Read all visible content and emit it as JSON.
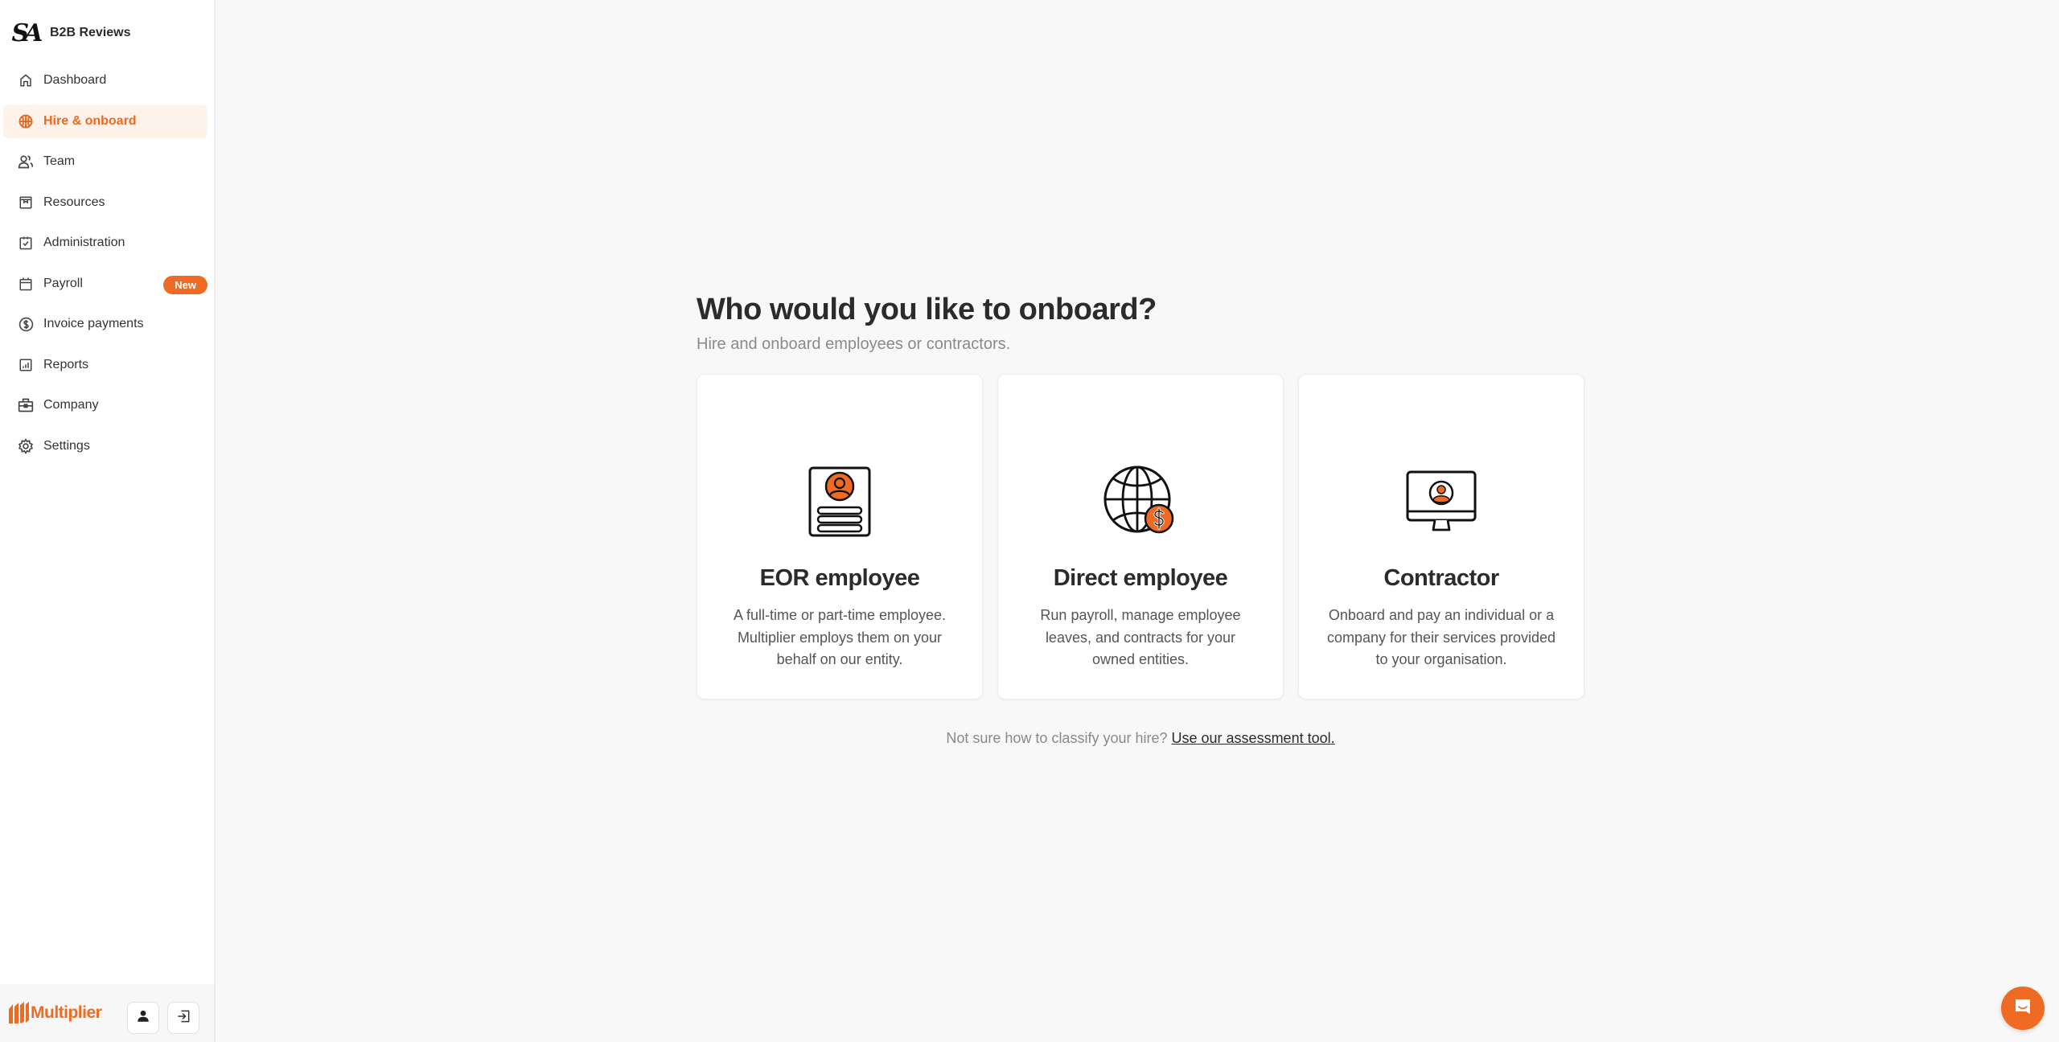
{
  "sidebar": {
    "brand_logo_text": "SA",
    "brand_name": "B2B Reviews",
    "items": [
      {
        "label": "Dashboard",
        "icon": "home-icon",
        "active": false
      },
      {
        "label": "Hire & onboard",
        "icon": "globe-icon",
        "active": true
      },
      {
        "label": "Team",
        "icon": "users-icon",
        "active": false
      },
      {
        "label": "Resources",
        "icon": "archive-icon",
        "active": false
      },
      {
        "label": "Administration",
        "icon": "clipboard-check-icon",
        "active": false
      },
      {
        "label": "Payroll",
        "icon": "calendar-icon",
        "active": false,
        "badge": "New"
      },
      {
        "label": "Invoice payments",
        "icon": "dollar-circle-icon",
        "active": false
      },
      {
        "label": "Reports",
        "icon": "bar-chart-icon",
        "active": false
      },
      {
        "label": "Company",
        "icon": "briefcase-icon",
        "active": false
      },
      {
        "label": "Settings",
        "icon": "gear-icon",
        "active": false
      }
    ],
    "footer": {
      "logo_text": "Multiplier",
      "profile_icon": "user-icon",
      "logout_icon": "logout-icon"
    }
  },
  "main": {
    "title": "Who would you like to onboard?",
    "subtitle": "Hire and onboard employees or contractors.",
    "cards": [
      {
        "title": "EOR employee",
        "description": "A full-time or part-time employee. Multiplier employs them on your behalf on our entity.",
        "icon": "id-card-icon"
      },
      {
        "title": "Direct employee",
        "description": "Run payroll, manage employee leaves, and contracts for your owned entities.",
        "icon": "globe-dollar-icon"
      },
      {
        "title": "Contractor",
        "description": "Onboard and pay an individual or a company for their services provided to your organisation.",
        "icon": "monitor-user-icon"
      }
    ],
    "helper_text": "Not sure how to classify your hire?",
    "helper_link": "Use our assessment tool."
  },
  "chat": {
    "icon": "chat-icon"
  },
  "colors": {
    "accent": "#ef6a22",
    "active_bg": "#fdf3ea",
    "text": "#2b2b2b",
    "muted": "#8a8a8a"
  }
}
